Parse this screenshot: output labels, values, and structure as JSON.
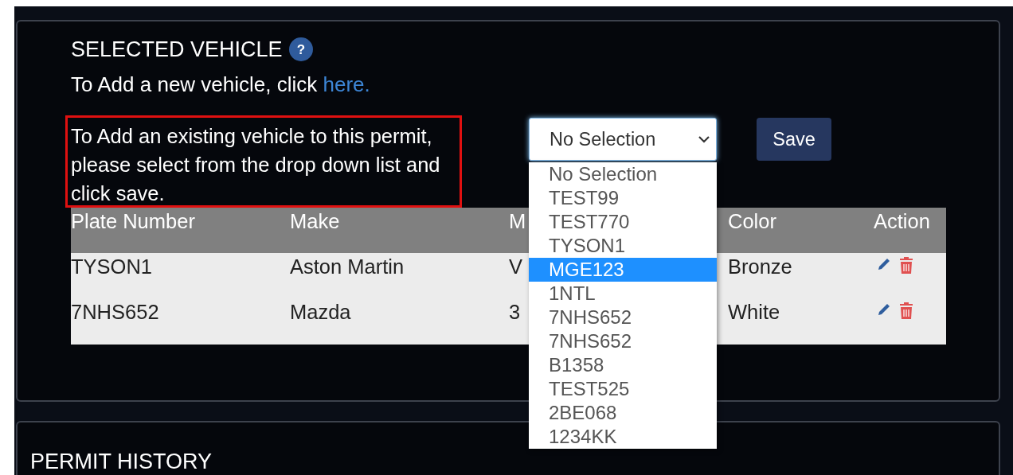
{
  "selected_vehicle": {
    "title": "SELECTED VEHICLE",
    "help_icon": "?",
    "add_new_text": "To Add a new vehicle, click ",
    "add_new_link": "here.",
    "add_existing_text": "To Add an existing vehicle to this permit, please select from the drop down list and click save.",
    "vehicle_select": {
      "value": "No Selection",
      "expanded": true,
      "options": [
        {
          "label": "No Selection",
          "highlighted": false
        },
        {
          "label": "TEST99",
          "highlighted": false
        },
        {
          "label": "TEST770",
          "highlighted": false
        },
        {
          "label": "TYSON1",
          "highlighted": false
        },
        {
          "label": "MGE123",
          "highlighted": true
        },
        {
          "label": "1NTL",
          "highlighted": false
        },
        {
          "label": "7NHS652",
          "highlighted": false
        },
        {
          "label": "7NHS652",
          "highlighted": false
        },
        {
          "label": "B1358",
          "highlighted": false
        },
        {
          "label": "TEST525",
          "highlighted": false
        },
        {
          "label": "2BE068",
          "highlighted": false
        },
        {
          "label": "1234KK",
          "highlighted": false
        }
      ]
    },
    "save_button": "Save",
    "table": {
      "columns": [
        "Plate Number",
        "Make",
        "M",
        "Color",
        "Action"
      ],
      "rows": [
        {
          "cells": [
            "TYSON1",
            "Aston Martin",
            "V",
            "Bronze"
          ]
        },
        {
          "cells": [
            "7NHS652",
            "Mazda",
            "3",
            "White"
          ]
        }
      ]
    }
  },
  "permit_history": {
    "title": "PERMIT HISTORY"
  }
}
